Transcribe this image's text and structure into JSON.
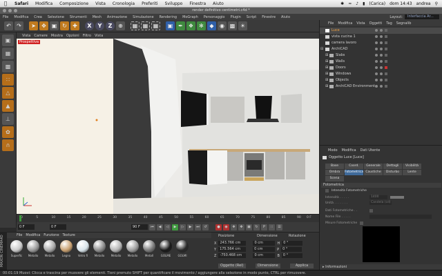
{
  "mac_menu": {
    "items": [
      "Safari",
      "Modifica",
      "Composizione",
      "Vista",
      "Cronologia",
      "Preferiti",
      "Sviluppo",
      "Finestra",
      "Aiuto"
    ],
    "battery": "(Carica)",
    "clock": "dom 14:43",
    "user": "andrea"
  },
  "window_title": "render definitivo centimetri.c4d *",
  "app_menu": {
    "items": [
      "File",
      "Modifica",
      "Crea",
      "Selezione",
      "Strumenti",
      "Mesh",
      "Animazione",
      "Simulazione",
      "Rendering",
      "MoGraph",
      "Personaggio",
      "Plugin",
      "Script",
      "Finestre",
      "Aiuto"
    ],
    "layout_label": "Layout:",
    "layout_value": "Interfaccia Ar..."
  },
  "toolbar": {
    "axis_x": "X",
    "axis_y": "Y",
    "axis_z": "Z"
  },
  "viewport": {
    "menu": [
      "Vista",
      "Camere",
      "Mostra",
      "Opzioni",
      "Filtro",
      "Vista"
    ],
    "label": "Prospettiva"
  },
  "timeline": {
    "ticks": [
      "0",
      "5",
      "10",
      "15",
      "20",
      "25",
      "30",
      "35",
      "40",
      "45",
      "50",
      "55",
      "60",
      "65",
      "70",
      "75",
      "80",
      "85",
      "90"
    ],
    "end_tick": "0 F",
    "current_frame": "0 F",
    "start_field": "0 F",
    "end_field": "90 F",
    "end_field2": "90 F"
  },
  "materials": {
    "menu": [
      "File",
      "Modifica",
      "Funzione",
      "Texture"
    ],
    "items": [
      {
        "label": "Superfic",
        "color": "#c9c9c9"
      },
      {
        "label": "Metallo",
        "color": "#9a9a9a"
      },
      {
        "label": "Metallo",
        "color": "#a8a8a8"
      },
      {
        "label": "Legno",
        "color": "#c8a070"
      },
      {
        "label": "Vetro fi",
        "color": "#d8e4ea"
      },
      {
        "label": "Metallo",
        "color": "#8c8c8c"
      },
      {
        "label": "Metallo",
        "color": "#b4b4b4"
      },
      {
        "label": "Metallo",
        "color": "#9e9e9e"
      },
      {
        "label": "Metall",
        "color": "#7a7a7a"
      },
      {
        "label": "GOLME",
        "color": "#1a1a1a"
      },
      {
        "label": "GOLMI",
        "color": "#2a2a2a"
      }
    ],
    "logo": "MAXON CINEMA4D"
  },
  "coordinates": {
    "headers": [
      "Posizione",
      "Dimensione",
      "Rotazione"
    ],
    "rows": [
      {
        "axis": "X",
        "pos": "243.766 cm",
        "dim": "0 cm",
        "rot_axis": "H",
        "rot": "0 °"
      },
      {
        "axis": "Y",
        "pos": "175.564 cm",
        "dim": "0 cm",
        "rot_axis": "P",
        "rot": "0 °"
      },
      {
        "axis": "Z",
        "pos": "-750.468 cm",
        "dim": "0 cm",
        "rot_axis": "B",
        "rot": "0 °"
      }
    ],
    "mode_select": "Oggetto (Rel)",
    "dim_select": "Dimensione",
    "apply_label": "Applica"
  },
  "status_bar": "00:01:19  Muovi: Clicca e trascina per muovere gli elementi. Tieni premuto SHIFT per quantificare il movimento / aggiungere alla selezione in modo punto, CTRL per rimuovere.",
  "objects": {
    "menu": [
      "File",
      "Modifica",
      "Vista",
      "Oggetti",
      "Tag",
      "Segnalib"
    ],
    "items": [
      {
        "name": "Luce",
        "indent": 0,
        "selected": true
      },
      {
        "name": "vista cucina 1",
        "indent": 0,
        "selected": false
      },
      {
        "name": "camera lavoro",
        "indent": 0,
        "selected": false
      },
      {
        "name": "ArchiCAD",
        "indent": 0,
        "selected": false
      },
      {
        "name": "Slabs",
        "indent": 1,
        "selected": false
      },
      {
        "name": "Walls",
        "indent": 1,
        "selected": false
      },
      {
        "name": "Doors",
        "indent": 1,
        "selected": false
      },
      {
        "name": "Windows",
        "indent": 1,
        "selected": false
      },
      {
        "name": "Objects",
        "indent": 1,
        "selected": false
      },
      {
        "name": "ArchiCAD Environment",
        "indent": 1,
        "selected": false
      }
    ]
  },
  "attributes": {
    "menu": [
      "Modo",
      "Modifica",
      "Dati Utente"
    ],
    "title": "Oggetto Luce [Luce]",
    "tabs_row1": [
      "Base",
      "Coord.",
      "Generale",
      "Dettagli",
      "Visibilità"
    ],
    "tabs_row2": [
      "Ombra",
      "Fotometrica",
      "Caustiche",
      "Disturbo",
      "Lente"
    ],
    "tabs_row3": [
      "Scena"
    ],
    "active_tab": "Fotometrica",
    "section": "Fotometrica",
    "rows": [
      {
        "label": "Intensità Fotometriche",
        "value": ""
      },
      {
        "label": "Intensità . . . . .",
        "value": "1400"
      },
      {
        "label": "Unità . . . . . . .",
        "value": "Candela (cd)"
      }
    ],
    "rows2": [
      {
        "label": "Dati Fotometriche . .",
        "value": ""
      },
      {
        "label": "Nome File . . . . .",
        "value": ""
      }
    ],
    "preview_label": "Misure Fotometriche",
    "info_label": "Informazioni"
  },
  "colors": {
    "accent": "#3f6a9a",
    "selection": "#f0a040",
    "viewport_bg": "#f4f2ee"
  }
}
